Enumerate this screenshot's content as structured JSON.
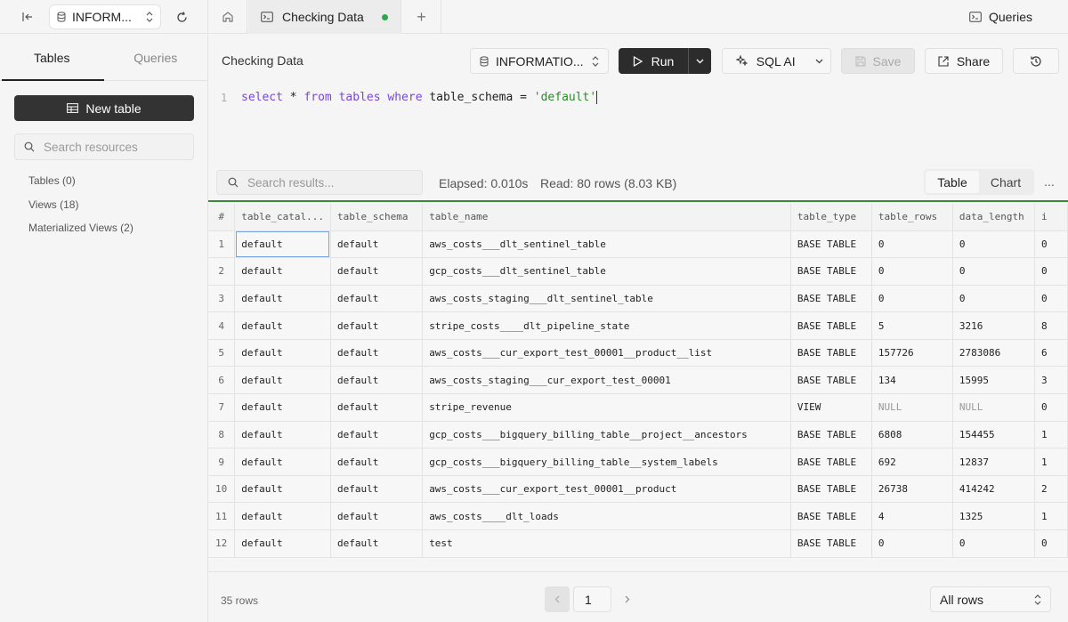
{
  "topbar": {
    "database_short": "INFORM...",
    "active_tab": "Checking Data",
    "queries_label": "Queries"
  },
  "sidebar": {
    "tabs": [
      "Tables",
      "Queries"
    ],
    "new_table_label": "New table",
    "search_placeholder": "Search resources",
    "items": [
      "Tables (0)",
      "Views (18)",
      "Materialized Views (2)"
    ]
  },
  "toolbar": {
    "title": "Checking Data",
    "database": "INFORMATIO...",
    "run_label": "Run",
    "sql_ai_label": "SQL AI",
    "save_label": "Save",
    "share_label": "Share"
  },
  "editor": {
    "line_number": "1",
    "tokens": {
      "t1": "select",
      "t2": " * ",
      "t3": "from",
      "t4": " ",
      "t5": "tables",
      "t6": " ",
      "t7": "where",
      "t8": " table_schema = ",
      "t9": "'default'"
    }
  },
  "results": {
    "search_placeholder": "Search results...",
    "elapsed": "Elapsed: 0.010s",
    "read": "Read: 80 rows (8.03 KB)",
    "view_options": [
      "Table",
      "Chart"
    ],
    "active_view": "Table",
    "more": "..."
  },
  "table": {
    "columns": [
      "#",
      "table_catal...",
      "table_schema",
      "table_name",
      "table_type",
      "table_rows",
      "data_length",
      "i"
    ],
    "rows": [
      [
        "1",
        "default",
        "default",
        "aws_costs___dlt_sentinel_table",
        "BASE TABLE",
        "0",
        "0",
        "0"
      ],
      [
        "2",
        "default",
        "default",
        "gcp_costs___dlt_sentinel_table",
        "BASE TABLE",
        "0",
        "0",
        "0"
      ],
      [
        "3",
        "default",
        "default",
        "aws_costs_staging___dlt_sentinel_table",
        "BASE TABLE",
        "0",
        "0",
        "0"
      ],
      [
        "4",
        "default",
        "default",
        "stripe_costs____dlt_pipeline_state",
        "BASE TABLE",
        "5",
        "3216",
        "8"
      ],
      [
        "5",
        "default",
        "default",
        "aws_costs___cur_export_test_00001__product__list",
        "BASE TABLE",
        "157726",
        "2783086",
        "6"
      ],
      [
        "6",
        "default",
        "default",
        "aws_costs_staging___cur_export_test_00001",
        "BASE TABLE",
        "134",
        "15995",
        "3"
      ],
      [
        "7",
        "default",
        "default",
        "stripe_revenue",
        "VIEW",
        "NULL",
        "NULL",
        "0"
      ],
      [
        "8",
        "default",
        "default",
        "gcp_costs___bigquery_billing_table__project__ancestors",
        "BASE TABLE",
        "6808",
        "154455",
        "1"
      ],
      [
        "9",
        "default",
        "default",
        "gcp_costs___bigquery_billing_table__system_labels",
        "BASE TABLE",
        "692",
        "12837",
        "1"
      ],
      [
        "10",
        "default",
        "default",
        "aws_costs___cur_export_test_00001__product",
        "BASE TABLE",
        "26738",
        "414242",
        "2"
      ],
      [
        "11",
        "default",
        "default",
        "aws_costs____dlt_loads",
        "BASE TABLE",
        "4",
        "1325",
        "1"
      ],
      [
        "12",
        "default",
        "default",
        "test",
        "BASE TABLE",
        "0",
        "0",
        "0"
      ]
    ]
  },
  "footer": {
    "row_count": "35 rows",
    "page": "1",
    "rows_option": "All rows"
  }
}
